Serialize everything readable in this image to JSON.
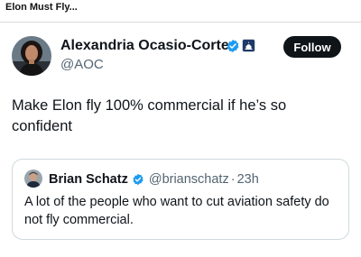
{
  "page": {
    "title": "Elon Must Fly..."
  },
  "tweet": {
    "author_name": "Alexandria Ocasio-Cortez",
    "author_handle": "@AOC",
    "follow_label": "Follow",
    "text": "Make Elon fly 100% commercial if he’s so confident"
  },
  "quote": {
    "author_name": "Brian Schatz",
    "author_handle": "@brianschatz",
    "separator": "·",
    "time": "23h",
    "text": "A lot of the people who want to cut aviation safety do not fly commercial."
  },
  "colors": {
    "verified": "#1d9bf0",
    "follow_bg": "#0f1419",
    "secondary_text": "#536471",
    "border": "#cfd9de"
  },
  "icons": {
    "verified": "verified-badge-icon",
    "affiliation": "capitol-affiliation-icon"
  }
}
